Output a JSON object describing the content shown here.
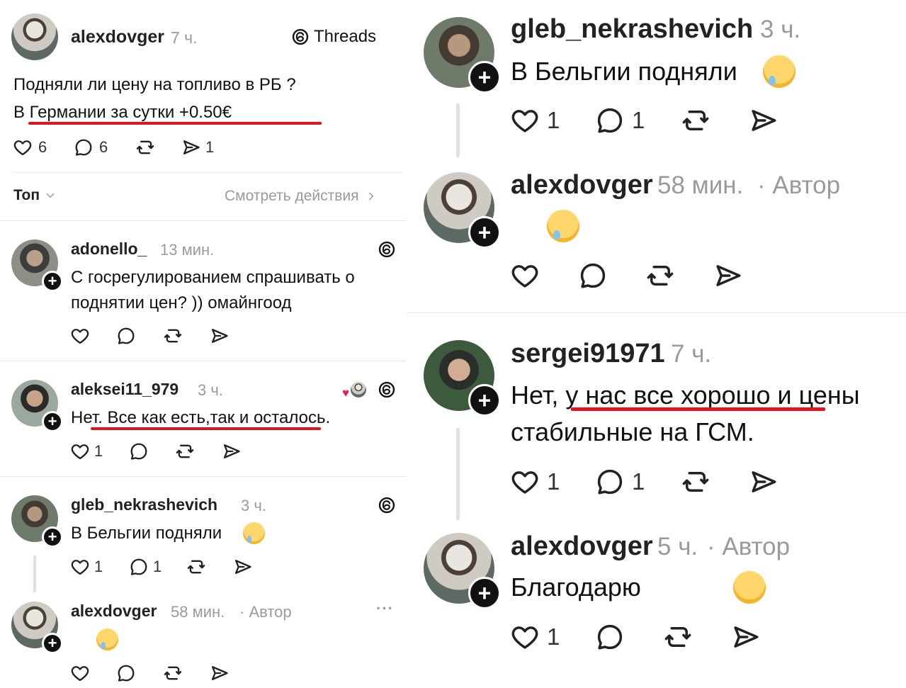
{
  "left": {
    "post": {
      "username": "alexdovger",
      "time": "7 ч.",
      "badge": "Threads",
      "line1": "Подняли ли цену на топливо в РБ ?",
      "line2": "В Германии за сутки +0.50€",
      "likes": "6",
      "replies": "6",
      "shares": "1"
    },
    "sort": {
      "label": "Топ",
      "action": "Смотреть действия"
    },
    "comments": [
      {
        "username": "adonello_",
        "time": "13 мин.",
        "line1": "С госрегулированием спрашивать о",
        "line2": "поднятии цен? )) омайнгоод"
      },
      {
        "username": "aleksei11_979",
        "time": "3 ч.",
        "text": "Нет. Все как есть,так и осталось.",
        "likes": "1"
      },
      {
        "username": "gleb_nekrashevich",
        "time": "3 ч.",
        "text": "В Бельгии подняли",
        "likes": "1",
        "replies": "1"
      },
      {
        "username": "alexdovger",
        "time": "58 мин.",
        "author": "· Автор",
        "more": "···"
      }
    ]
  },
  "right": {
    "comments": [
      {
        "username": "gleb_nekrashevich",
        "time": "3 ч.",
        "text": "В Бельгии подняли",
        "likes": "1",
        "replies": "1"
      },
      {
        "username": "alexdovger",
        "time": "58 мин.",
        "author": "· Автор"
      },
      {
        "username": "sergei91971",
        "time": "7 ч.",
        "line1a": "Нет, ",
        "line1b": "у нас все хорошо и",
        "line1c": " цены",
        "line2": "стабильные на ГСМ.",
        "likes": "1",
        "replies": "1"
      },
      {
        "username": "alexdovger",
        "time": "5 ч.",
        "author": "· Автор",
        "text": "Благодарю",
        "likes": "1"
      }
    ]
  },
  "colors": {
    "underline": "#e0141e",
    "muted": "#9a9a9a"
  }
}
